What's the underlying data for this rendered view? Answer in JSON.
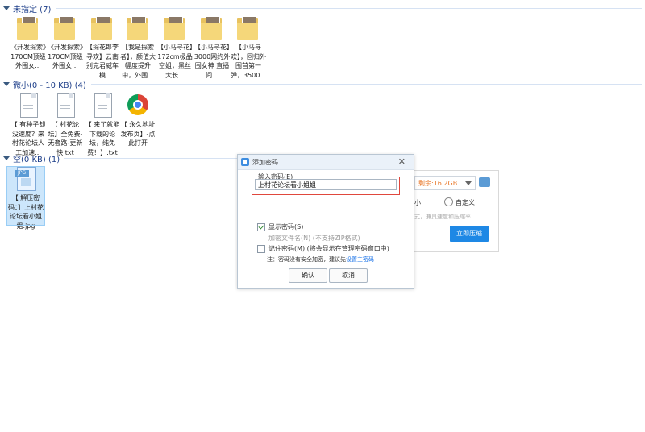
{
  "groups": [
    {
      "title": "未指定 (7)",
      "items": [
        {
          "label": "《开发探索》170CM顶级外围女..."
        },
        {
          "label": "《开发探索》170CM顶级外围女..."
        },
        {
          "label": "【探花郎李寻欢】云南别克君威车模"
        },
        {
          "label": "【我是探索者】，颜值大幅度提升中，外围..."
        },
        {
          "label": "【小马寻花】172cm极品空姐，黑丝大长..."
        },
        {
          "label": "【小马寻花】3000网约外围女神 直播间..."
        },
        {
          "label": "【小马寻欢】，回归外围首第一弹，3500..."
        }
      ]
    },
    {
      "title": "微小(0 - 10 KB) (4)",
      "items": [
        {
          "label": "【 有种子却没速度？来村花论坛人工加速..."
        },
        {
          "label": "【 村花论坛】全免费-无套路-更新快.txt"
        },
        {
          "label": "【 来了就能下载的论坛，纯免费！】.txt"
        },
        {
          "label": "【 永久地址发布页】-点此打开"
        }
      ]
    },
    {
      "title": "空(0 KB) (1)",
      "items": [
        {
          "label": "【 解压密码：】上村花论坛看小姐姐.jpg",
          "tag": "JPG"
        }
      ]
    }
  ],
  "back_panel": {
    "size_text": "剩余:16.2GB",
    "option_small": "小",
    "option_custom": "自定义",
    "hint": "式，兼具速度和压缩率",
    "compress_button": "立即压缩"
  },
  "dialog": {
    "title": "添加密码",
    "close": "✕",
    "password_label": "输入密码(E)",
    "password_value": "上村花论坛看小姐姐",
    "show_password": "显示密码(S)",
    "encrypt_filename": "加密文件名(N) (不支持ZIP格式)",
    "remember_password": "记住密码(M) (将会显示在管理密码窗口中)",
    "note_prefix": "注：密码没有安全加密，建议先",
    "note_link": "设置主密码",
    "ok": "确认",
    "cancel": "取消",
    "checkboxes": {
      "show_password": true,
      "encrypt_filename": false,
      "remember_password": false
    }
  },
  "colors": {
    "group_title": "#1e3f8a",
    "highlight": "#e0473d",
    "primary_button": "#1e88e5",
    "size_text": "#e9792b",
    "link": "#1a73e8"
  },
  "icons": {
    "folder": "folder-photo-icon",
    "text": "text-file-icon",
    "chrome": "chrome-icon",
    "jpg": "jpg-file-icon"
  }
}
